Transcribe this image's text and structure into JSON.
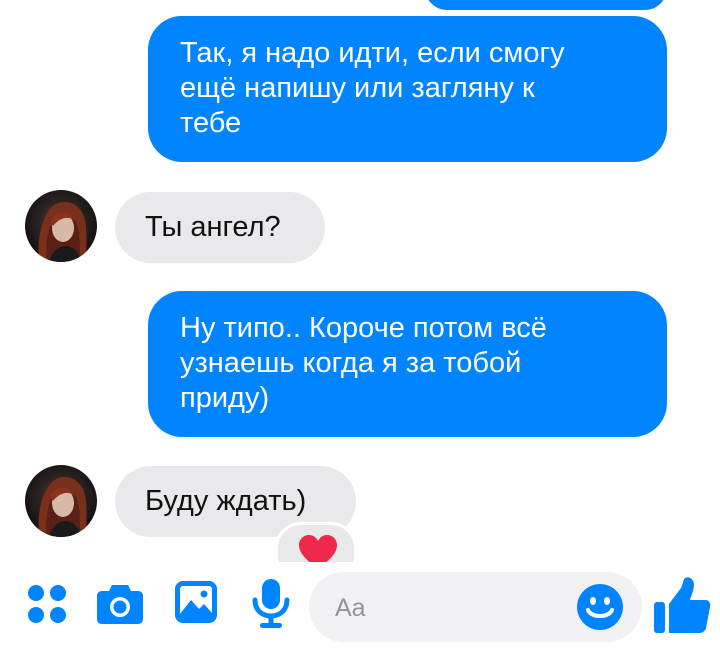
{
  "messages": [
    {
      "id": "m0",
      "direction": "outgoing",
      "text": ""
    },
    {
      "id": "m1",
      "direction": "outgoing",
      "lines": [
        "Так, я надо идти, если смогу",
        "ещё напишу или загляну к",
        "тебе"
      ]
    },
    {
      "id": "m2",
      "direction": "incoming",
      "text": "Ты ангел?"
    },
    {
      "id": "m3",
      "direction": "outgoing",
      "lines": [
        "Ну типо.. Короче потом всё",
        "узнаешь когда я за тобой",
        "приду)"
      ]
    },
    {
      "id": "m4",
      "direction": "incoming",
      "text": "Буду ждать)",
      "reaction": "heart-reaction-icon"
    }
  ],
  "composer": {
    "placeholder": "Aa",
    "icons": [
      "more-icon",
      "camera-icon",
      "photo-icon",
      "mic-icon",
      "emoji-icon",
      "like-icon"
    ]
  },
  "colors": {
    "accent": "#0084ff",
    "incoming_bubble": "#e9e9eb",
    "outgoing_text": "#ffffff",
    "heart": "#f0284a"
  }
}
